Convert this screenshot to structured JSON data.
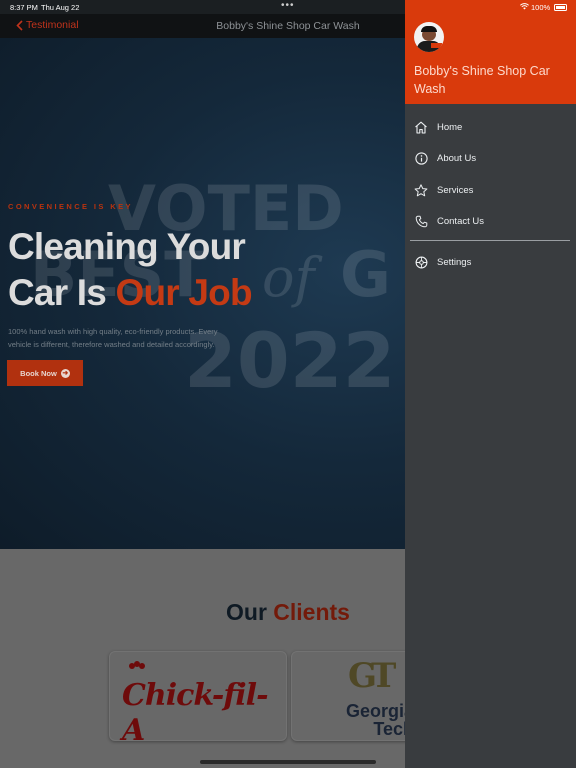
{
  "status_bar": {
    "time": "8:37 PM",
    "date": "Thu Aug 22",
    "dots": "•••",
    "battery": "100%",
    "icons": [
      "wifi-icon",
      "battery-icon"
    ]
  },
  "nav": {
    "back_label": "Testimonial",
    "title": "Bobby's Shine Shop Car Wash"
  },
  "hero": {
    "watermark": {
      "line1": "VOTED",
      "best": "BEST",
      "of": "of",
      "g": "G",
      "year": "2022"
    },
    "tagline": "CONVENIENCE IS KEY",
    "heading_line1": "Cleaning Your",
    "heading_line2_plain": "Car Is ",
    "heading_line2_accent": "Our Job",
    "description": "100% hand wash with high quality, eco-friendly products. Every vehicle is different, therefore washed and detailed accordingly.",
    "cta_label": "Book Now"
  },
  "clients": {
    "title_plain": "Our",
    "title_accent": "Clients",
    "logos": [
      {
        "name": "Chick-fil-A",
        "text": "Chick-fil-A"
      },
      {
        "name": "Georgia Tech",
        "monogram": "GT",
        "line1": "Georgia",
        "line2": "Tech"
      }
    ]
  },
  "drawer": {
    "title": "Bobby's Shine Shop Car Wash",
    "menu": [
      {
        "label": "Home",
        "icon": "home-icon"
      },
      {
        "label": "About Us",
        "icon": "info-icon"
      },
      {
        "label": "Services",
        "icon": "star-icon"
      },
      {
        "label": "Contact Us",
        "icon": "phone-icon"
      }
    ],
    "settings": {
      "label": "Settings",
      "icon": "settings-icon"
    }
  },
  "colors": {
    "accent": "#d93a0c",
    "drawer_bg": "#393c3f",
    "hero_bg": "#14283a",
    "cta": "#b1310f"
  }
}
